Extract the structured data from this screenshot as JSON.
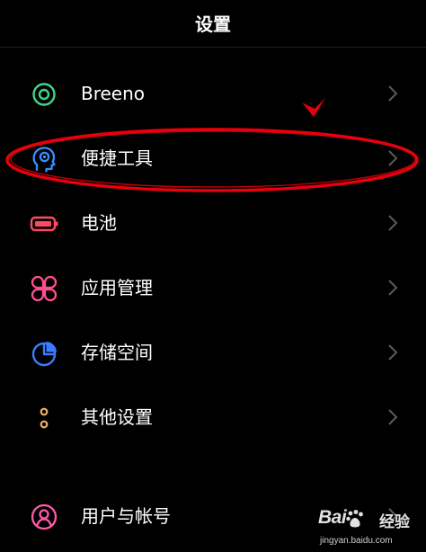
{
  "header": {
    "title": "设置"
  },
  "settings": {
    "items": [
      {
        "label": "Breeno",
        "icon": "breeno-icon",
        "icon_color": "#3fd68a"
      },
      {
        "label": "便捷工具",
        "icon": "convenience-tools-icon",
        "icon_color": "#3a8cff"
      },
      {
        "label": "电池",
        "icon": "battery-icon",
        "icon_color": "#ff4a5e"
      },
      {
        "label": "应用管理",
        "icon": "app-management-icon",
        "icon_color": "#ff4f8e"
      },
      {
        "label": "存储空间",
        "icon": "storage-icon",
        "icon_color": "#3b7cff"
      },
      {
        "label": "其他设置",
        "icon": "other-settings-icon",
        "icon_color": "#e8b26a"
      },
      {
        "label": "用户与帐号",
        "icon": "user-account-icon",
        "icon_color": "#ff5aa8"
      }
    ]
  },
  "annotation": {
    "color": "#e8000c"
  },
  "watermark": {
    "brand": "Bai",
    "suffix": "经验",
    "url": "jingyan.baidu.com"
  }
}
